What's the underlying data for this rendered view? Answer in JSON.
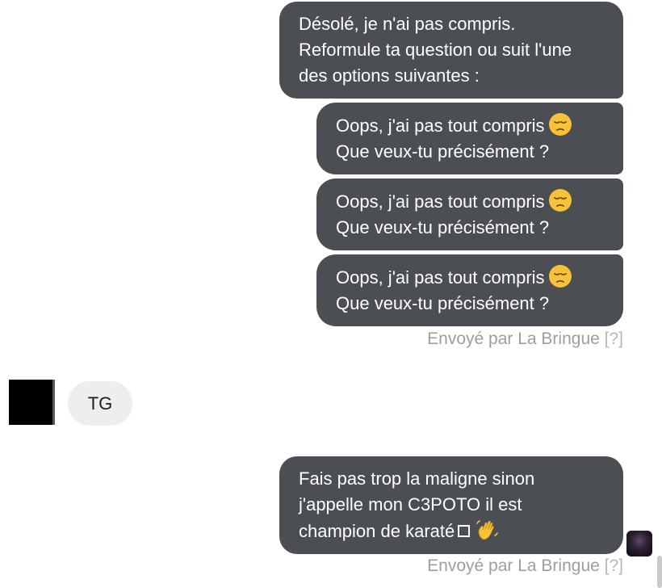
{
  "messages": {
    "bot_intro": {
      "lines": [
        "Désolé, je n'ai pas compris.",
        "Reformule ta question ou suit l'une",
        "des options suivantes :"
      ]
    },
    "options": [
      {
        "line1": "Oops, j'ai pas tout compris",
        "line2": "Que veux-tu précisément ?",
        "emoji": "pensive-face-emoji"
      },
      {
        "line1": "Oops, j'ai pas tout compris",
        "line2": "Que veux-tu précisément ?",
        "emoji": "pensive-face-emoji"
      },
      {
        "line1": "Oops, j'ai pas tout compris",
        "line2": "Que veux-tu précisément ?",
        "emoji": "pensive-face-emoji"
      }
    ],
    "sent_by_1": {
      "text": "Envoyé par La Bringue",
      "help": "[?]"
    },
    "user_reply": {
      "text": "TG"
    },
    "bot_reply": {
      "lines": [
        "Fais pas trop la maligne sinon",
        "j'appelle mon C3POTO il est",
        "champion de karaté"
      ],
      "emoji": "waving-hand-emoji",
      "glyph": "missing-glyph-square"
    },
    "sent_by_2": {
      "text": "Envoyé par La Bringue",
      "help": "[?]"
    }
  },
  "colors": {
    "bot_bubble": "#4b4e53",
    "user_bubble": "#eeeef0",
    "sent_by_text": "#9a9ea5",
    "emoji_yellow": "#f7c23a"
  }
}
